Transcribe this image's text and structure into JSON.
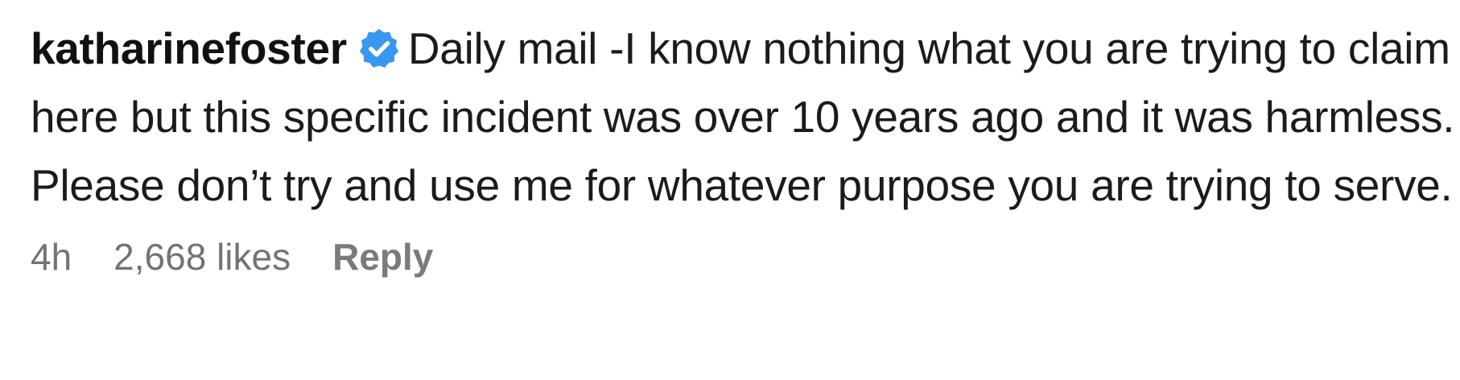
{
  "comment": {
    "username": "katharinefoster",
    "verified_icon": "verified-badge-icon",
    "accent_color": "#3897f0",
    "text": "Daily mail -I know nothing what you are trying to claim here but this specific incident was over 10 years ago and it was harmless. Please don’t try and use me for whatever purpose you are trying to serve.",
    "timestamp": "4h",
    "likes": "2,668 likes",
    "reply_label": "Reply"
  }
}
